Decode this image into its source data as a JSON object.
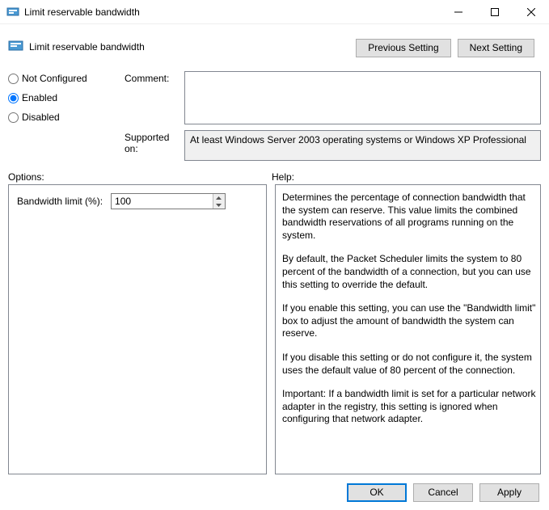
{
  "window": {
    "title": "Limit reservable bandwidth"
  },
  "header": {
    "policy_name": "Limit reservable bandwidth",
    "previous_label": "Previous Setting",
    "next_label": "Next Setting"
  },
  "config": {
    "radio_not_configured": "Not Configured",
    "radio_enabled": "Enabled",
    "radio_disabled": "Disabled",
    "selected": "enabled",
    "comment_label": "Comment:",
    "comment_value": "",
    "supported_label": "Supported on:",
    "supported_value": "At least Windows Server 2003 operating systems or Windows XP Professional"
  },
  "sections": {
    "options_label": "Options:",
    "help_label": "Help:"
  },
  "options": {
    "bandwidth_label": "Bandwidth limit (%):",
    "bandwidth_value": "100"
  },
  "help": {
    "p1": "Determines the percentage of connection bandwidth that the system can reserve. This value limits the combined bandwidth reservations of all programs running on the system.",
    "p2": "By default, the Packet Scheduler limits the system to 80 percent of the bandwidth of a connection, but you can use this setting to override the default.",
    "p3": "If you enable this setting, you can use the \"Bandwidth limit\" box to adjust the amount of bandwidth the system can reserve.",
    "p4": "If you disable this setting or do not configure it, the system uses the default value of 80 percent of the connection.",
    "p5": "Important: If a bandwidth limit is set for a particular network adapter in the registry, this setting is ignored when configuring that network adapter."
  },
  "footer": {
    "ok": "OK",
    "cancel": "Cancel",
    "apply": "Apply"
  }
}
